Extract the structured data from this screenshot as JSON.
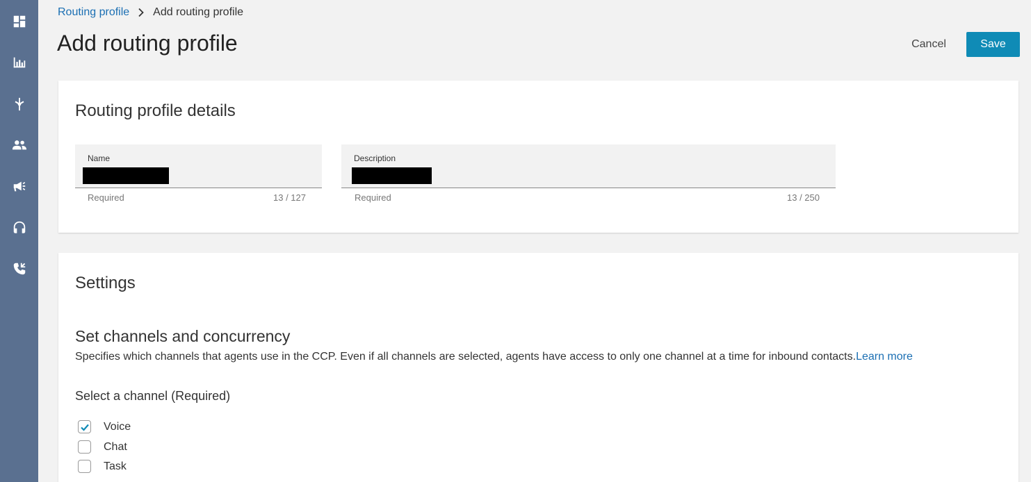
{
  "sidebar": {
    "icons": [
      "dashboard-icon",
      "metrics-icon",
      "routing-icon",
      "users-icon",
      "campaigns-icon",
      "headset-icon",
      "phone-icon"
    ]
  },
  "breadcrumb": {
    "parent": "Routing profile",
    "current": "Add routing profile"
  },
  "header": {
    "title": "Add routing profile",
    "cancel_label": "Cancel",
    "save_label": "Save"
  },
  "details": {
    "title": "Routing profile details",
    "name": {
      "label": "Name",
      "helper": "Required",
      "count": "13 / 127"
    },
    "description": {
      "label": "Description",
      "helper": "Required",
      "count": "13 / 250"
    }
  },
  "settings": {
    "title": "Settings",
    "section_title": "Set channels and concurrency",
    "section_desc": "Specifies which channels that agents use in the CCP. Even if all channels are selected, agents have access to only one channel at a time for inbound contacts.",
    "learn_more": "Learn more",
    "select_label": "Select a channel (Required)",
    "channels": [
      {
        "label": "Voice",
        "checked": true
      },
      {
        "label": "Chat",
        "checked": false
      },
      {
        "label": "Task",
        "checked": false
      }
    ]
  },
  "colors": {
    "sidebar": "#5a7090",
    "accent": "#0f8bb6",
    "link": "#1b6fb3"
  }
}
